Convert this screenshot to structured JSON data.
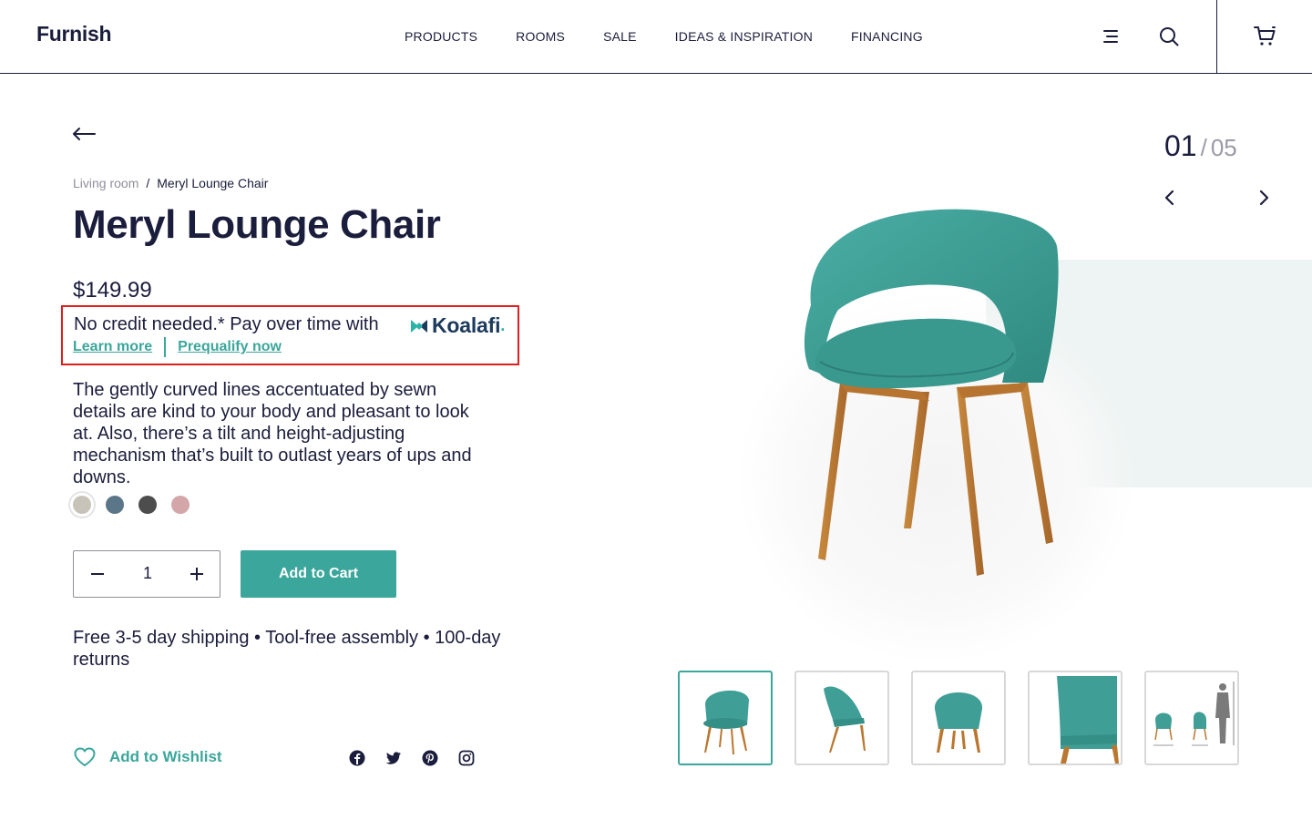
{
  "header": {
    "logo": "Furnish",
    "nav": [
      "PRODUCTS",
      "ROOMS",
      "SALE",
      "IDEAS & INSPIRATION",
      "FINANCING"
    ],
    "icons": [
      "menu-icon",
      "search-icon",
      "cart-icon"
    ]
  },
  "breadcrumb": {
    "parent": "Living room",
    "separator": "/",
    "current": "Meryl Lounge Chair"
  },
  "product": {
    "title": "Meryl Lounge Chair",
    "price": "$149.99",
    "description": "The gently curved lines accentuated by sewn details are kind to your body and pleasant to look at. Also, there’s a tilt and height-adjusting mechanism that’s built to outlast years of ups and downs.",
    "swatches": [
      {
        "name": "beige",
        "color": "#c7c3b9",
        "selected": true
      },
      {
        "name": "slate-blue",
        "color": "#5b7688",
        "selected": false
      },
      {
        "name": "charcoal",
        "color": "#4d4d4d",
        "selected": false
      },
      {
        "name": "dusty-pink",
        "color": "#d3a6a9",
        "selected": false
      }
    ],
    "quantity": "1",
    "add_to_cart": "Add to Cart",
    "perks": "Free 3-5 day shipping  •  Tool-free assembly  •  100-day returns",
    "wishlist": "Add to Wishlist"
  },
  "financing": {
    "text": "No credit needed.* Pay over time with",
    "brand": "Koalafi",
    "brand_dot": ".",
    "learn_more": "Learn more",
    "prequalify": "Prequalify now"
  },
  "gallery": {
    "current": "01",
    "separator": "/",
    "total": "05",
    "active_index": 0,
    "thumbnails": [
      "chair-front",
      "chair-side",
      "chair-back",
      "chair-detail",
      "chair-dimensions"
    ]
  },
  "socials": [
    "facebook-icon",
    "twitter-icon",
    "pinterest-icon",
    "instagram-icon"
  ],
  "colors": {
    "navy": "#1b1d3c",
    "teal": "#3ba69b",
    "highlight": "#e01e1e",
    "fabric": "#3f9e95",
    "wood": "#b9772f"
  }
}
